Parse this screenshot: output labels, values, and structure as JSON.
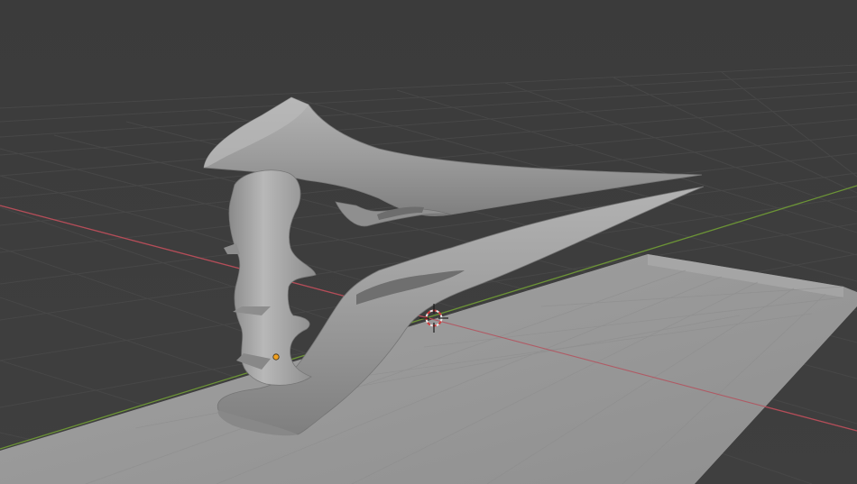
{
  "viewport": {
    "background": "#3d3d3d",
    "grid_color": "#4a4a4a",
    "x_axis_color": "#b24a55",
    "y_axis_color": "#6f9a3a",
    "plane_color": "#9c9c9c",
    "model_color": "#a3a3a3",
    "origin_color": "#f0a020"
  },
  "objects": [
    {
      "name": "plane",
      "type": "mesh"
    },
    {
      "name": "energy-sword",
      "type": "mesh"
    }
  ],
  "cursor": {
    "icon": "3d-cursor-icon"
  }
}
